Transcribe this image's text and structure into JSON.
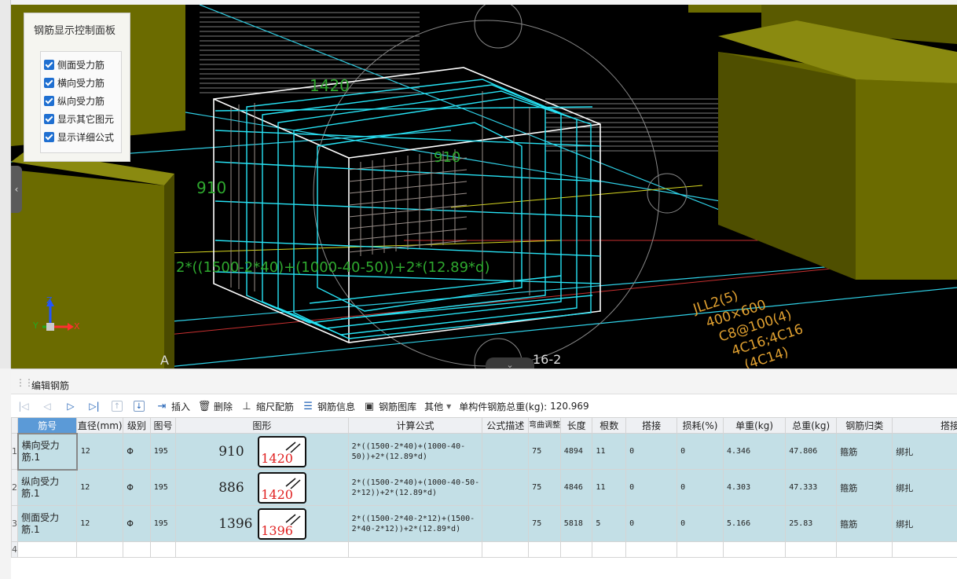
{
  "viewport": {
    "panel": {
      "title": "钢筋显示控制面板",
      "checkboxes": [
        {
          "label": "侧面受力筋",
          "checked": true
        },
        {
          "label": "横向受力筋",
          "checked": true
        },
        {
          "label": "纵向受力筋",
          "checked": true
        },
        {
          "label": "显示其它图元",
          "checked": true
        },
        {
          "label": "显示详细公式",
          "checked": true
        }
      ]
    },
    "canvas_labels": {
      "dim_top": "1420",
      "dim_left": "910",
      "dim_inner": "910",
      "formula": "2*((1500-2*40)+(1000-40-50))+2*(12.89*d)",
      "grid_label": "16-2",
      "axis_letter_a": "A",
      "beam_line1": "JLL2(5)",
      "beam_line2": "400×600",
      "beam_line3": "C8@100(4)",
      "beam_line4": "4C16;4C16",
      "beam_line5": "(4C14)",
      "axis_x": "X",
      "axis_y": "Y",
      "axis_z": "Z"
    },
    "colors": {
      "background": "#000000",
      "olive": "#6b6b00",
      "cyan": "#27e3f5"
    }
  },
  "editor": {
    "title": "编辑钢筋",
    "toolbar": {
      "insert": "插入",
      "delete": "删除",
      "scale_rebar": "缩尺配筋",
      "rebar_info": "钢筋信息",
      "rebar_library": "钢筋图库",
      "other": "其他",
      "total_weight_label": "单构件钢筋总重(kg):",
      "total_weight_value": "120.969"
    },
    "columns": [
      "筋号",
      "直径(mm)",
      "级别",
      "图号",
      "图形",
      "计算公式",
      "公式描述",
      "弯曲调整",
      "长度",
      "根数",
      "搭接",
      "损耗(%)",
      "单重(kg)",
      "总重(kg)",
      "钢筋归类",
      "搭接形"
    ],
    "rows": [
      {
        "num": "1",
        "name": "横向受力筋.1",
        "diameter": "12",
        "grade": "Φ",
        "fig": "195",
        "shape_num": "910",
        "shape_len": "1420",
        "formula": "2*((1500-2*40)+(1000-40-50))+2*(12.89*d)",
        "desc": "",
        "bend": "75",
        "length": "4894",
        "count": "11",
        "lap": "0",
        "loss": "0",
        "unit_w": "4.346",
        "total_w": "47.806",
        "category": "箍筋",
        "lap_type": "绑扎"
      },
      {
        "num": "2",
        "name": "纵向受力筋.1",
        "diameter": "12",
        "grade": "Φ",
        "fig": "195",
        "shape_num": "886",
        "shape_len": "1420",
        "formula": "2*((1500-2*40)+(1000-40-50-2*12))+2*(12.89*d)",
        "desc": "",
        "bend": "75",
        "length": "4846",
        "count": "11",
        "lap": "0",
        "loss": "0",
        "unit_w": "4.303",
        "total_w": "47.333",
        "category": "箍筋",
        "lap_type": "绑扎"
      },
      {
        "num": "3",
        "name": "侧面受力筋.1",
        "diameter": "12",
        "grade": "Φ",
        "fig": "195",
        "shape_num": "1396",
        "shape_len": "1396",
        "formula": "2*((1500-2*40-2*12)+(1500-2*40-2*12))+2*(12.89*d)",
        "desc": "",
        "bend": "75",
        "length": "5818",
        "count": "5",
        "lap": "0",
        "loss": "0",
        "unit_w": "5.166",
        "total_w": "25.83",
        "category": "箍筋",
        "lap_type": "绑扎"
      }
    ],
    "empty_row_num": "4"
  }
}
